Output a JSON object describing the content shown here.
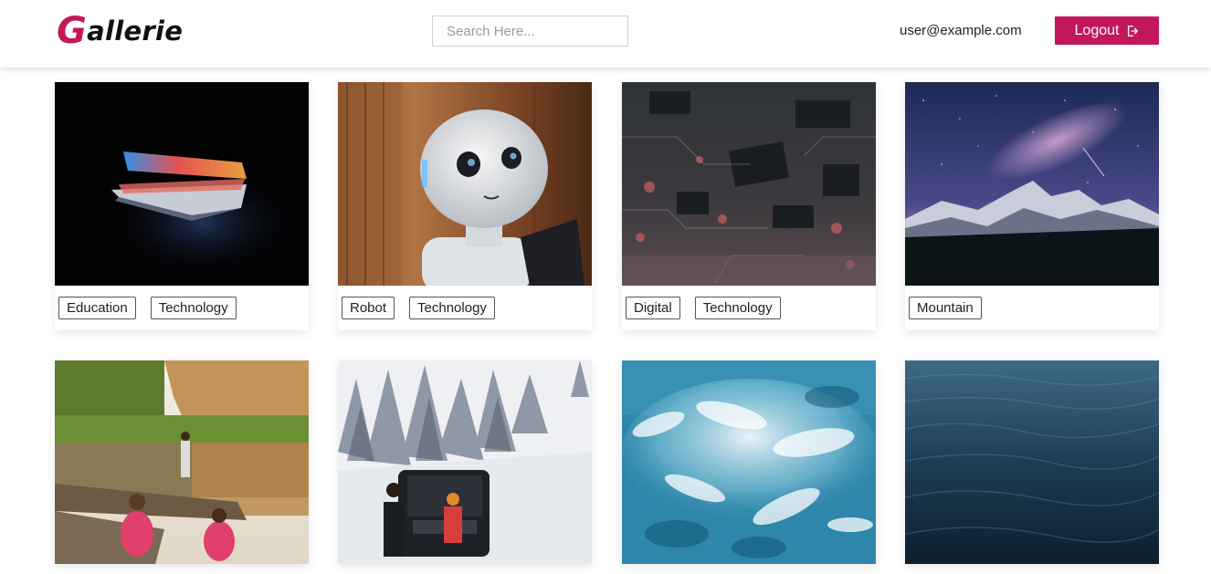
{
  "header": {
    "logo_first_letter": "G",
    "logo_rest": "allerie",
    "search_placeholder": "Search Here...",
    "user_email": "user@example.com",
    "logout_label": "Logout",
    "logout_icon": "sign-out-icon"
  },
  "colors": {
    "brand": "#c2185b",
    "header_background": "#ffffff",
    "tag_border": "#555555"
  },
  "gallery": {
    "cards": [
      {
        "image": "laptop-in-dark-photo",
        "tags": [
          "Education",
          "Technology"
        ]
      },
      {
        "image": "robot-photo",
        "tags": [
          "Robot",
          "Technology"
        ]
      },
      {
        "image": "circuit-board-photo",
        "tags": [
          "Digital",
          "Technology"
        ]
      },
      {
        "image": "mountain-night-sky-photo",
        "tags": [
          "Mountain"
        ]
      },
      {
        "image": "campers-by-lake-photo",
        "tags": []
      },
      {
        "image": "snowy-car-camping-photo",
        "tags": []
      },
      {
        "image": "ocean-waves-aerial-photo",
        "tags": []
      },
      {
        "image": "dark-ocean-water-photo",
        "tags": []
      }
    ]
  }
}
